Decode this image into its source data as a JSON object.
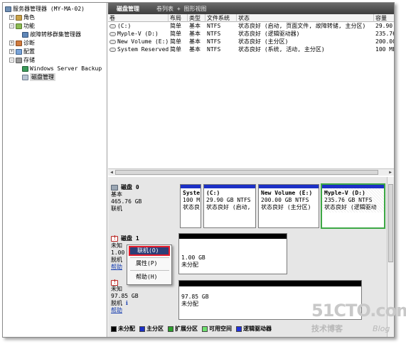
{
  "tree": {
    "root": "服务器管理器 (MY-MA-02)",
    "roles": "角色",
    "features": "功能",
    "cluster_mgr": "故障转移群集管理器",
    "diagnostics": "诊断",
    "configuration": "配置",
    "storage": "存储",
    "backup": "Windows Server Backup",
    "disk_mgmt": "磁盘管理"
  },
  "header": {
    "title": "磁盘管理",
    "views": "卷列表 + 图形视图"
  },
  "table": {
    "columns": [
      "卷",
      "布局",
      "类型",
      "文件系统",
      "状态",
      "容量"
    ],
    "rows": [
      {
        "vol": "(C:)",
        "layout": "简单",
        "type": "基本",
        "fs": "NTFS",
        "status": "状态良好 (启动, 页面文件, 故障转储, 主分区)",
        "cap": "29.90"
      },
      {
        "vol": "Myple-V (D:)",
        "layout": "简单",
        "type": "基本",
        "fs": "NTFS",
        "status": "状态良好 (逻辑驱动器)",
        "cap": "235.76"
      },
      {
        "vol": "New Volume (E:)",
        "layout": "简单",
        "type": "基本",
        "fs": "NTFS",
        "status": "状态良好 (主分区)",
        "cap": "200.00"
      },
      {
        "vol": "System Reserved",
        "layout": "简单",
        "type": "基本",
        "fs": "NTFS",
        "status": "状态良好 (系统, 活动, 主分区)",
        "cap": "100 ME"
      }
    ]
  },
  "disk0": {
    "name": "磁盘 0",
    "type": "基本",
    "size": "465.76 GB",
    "state": "联机",
    "parts": [
      {
        "l1": "Syste",
        "l2": "100 M",
        "l3": "状态良"
      },
      {
        "l1": "(C:)",
        "l2": "29.90 GB NTFS",
        "l3": "状态良好 (启动,"
      },
      {
        "l1": "New Volume  (E:)",
        "l2": "200.00 GB NTFS",
        "l3": "状态良好 (主分区)"
      },
      {
        "l1": "Myple-V  (D:)",
        "l2": "235.76 GB NTFS",
        "l3": "状态良好 (逻辑驱动"
      }
    ]
  },
  "disk1": {
    "name": "磁盘 1",
    "type": "未知",
    "size": "1.00",
    "state": "脱机",
    "help": "帮助",
    "part": {
      "l1": "1.00 GB",
      "l2": "未分配"
    }
  },
  "disk2": {
    "type": "未知",
    "size": "97.85 GB",
    "state": "脱机",
    "help": "帮助",
    "part": {
      "l1": "97.85 GB",
      "l2": "未分配"
    }
  },
  "menu": {
    "online": "联机(O)",
    "properties": "属性(P)",
    "help": "帮助(H)"
  },
  "legend": {
    "unallocated": "未分配",
    "primary": "主分区",
    "extended": "扩展分区",
    "free": "可用空间",
    "logical": "逻辑驱动器"
  },
  "colors": {
    "unallocated": "#000000",
    "primary": "#1c30c6",
    "extended": "#2ea02e",
    "free": "#6ee06e",
    "logical": "#2233dd"
  },
  "watermark": {
    "brand": "51CTO.com",
    "sub": "技术博客",
    "blog": "Blog"
  }
}
